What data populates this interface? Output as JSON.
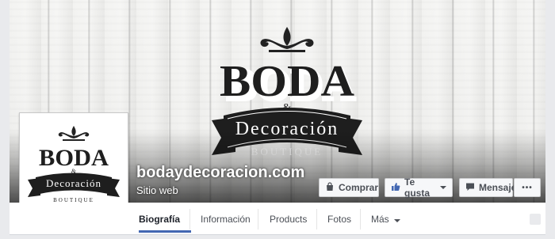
{
  "page": {
    "name": "bodaydecoracion.com",
    "category": "Sitio web"
  },
  "brand": {
    "word_top": "BODA",
    "ampersand": "&",
    "word_mid": "Decoración",
    "word_bottom": "BOUTIQUE"
  },
  "actions": {
    "buy": "Comprar",
    "like": "Te gusta",
    "message": "Mensaje",
    "more": "•••"
  },
  "tabs": [
    {
      "label": "Biografía",
      "active": true
    },
    {
      "label": "Información",
      "active": false
    },
    {
      "label": "Products",
      "active": false
    },
    {
      "label": "Fotos",
      "active": false
    },
    {
      "label": "Más",
      "active": false
    }
  ],
  "colors": {
    "accent": "#4267b2",
    "text": "#4b4f56"
  }
}
